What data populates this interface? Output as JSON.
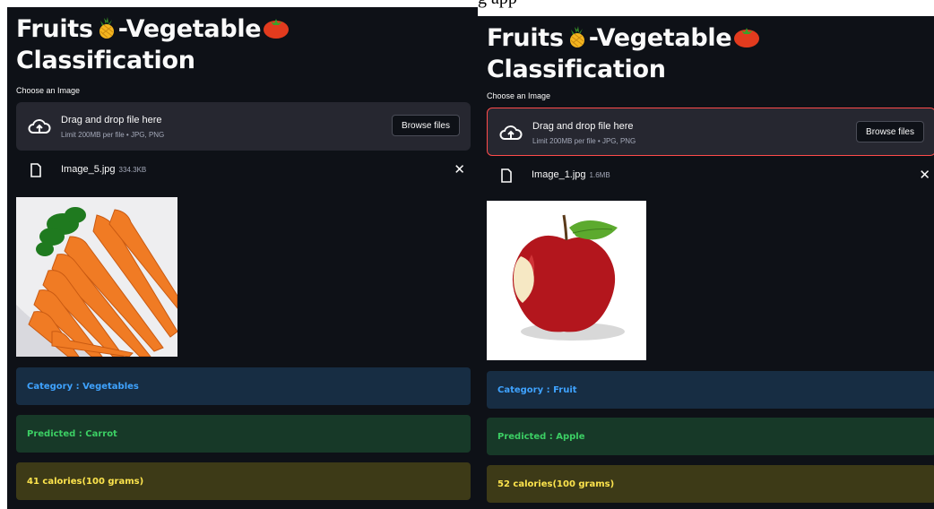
{
  "page": {
    "caption_fragment": "g app"
  },
  "colors": {
    "app_background": "#0e1117",
    "dropzone_background": "#262730",
    "info": "#3fa3ff",
    "success": "#3ccf64",
    "warning": "#fde44d",
    "focus_border": "#ff4b4b"
  },
  "panels": [
    {
      "title_part1": "Fruits",
      "title_part2": "-Vegetable",
      "title_part3": "Classification",
      "title_icons": [
        "pineapple-icon",
        "tomato-icon"
      ],
      "uploader_label": "Choose an Image",
      "dropzone_title": "Drag and drop file here",
      "dropzone_limit": "Limit 200MB per file • JPG, PNG",
      "browse_label": "Browse files",
      "file_name": "Image_5.jpg",
      "file_size": "334.3KB",
      "close_glyph": "✕",
      "image_subject": "carrots",
      "category": "Category : Vegetables",
      "predicted": "Predicted : Carrot",
      "calories": "41 calories(100 grams)"
    },
    {
      "title_part1": "Fruits",
      "title_part2": "-Vegetable",
      "title_part3": "Classification",
      "title_icons": [
        "pineapple-icon",
        "tomato-icon"
      ],
      "uploader_label": "Choose an Image",
      "dropzone_title": "Drag and drop file here",
      "dropzone_limit": "Limit 200MB per file • JPG, PNG",
      "browse_label": "Browse files",
      "file_name": "Image_1.jpg",
      "file_size": "1.6MB",
      "close_glyph": "✕",
      "image_subject": "apple",
      "category": "Category : Fruit",
      "predicted": "Predicted : Apple",
      "calories": "52 calories(100 grams)"
    }
  ]
}
